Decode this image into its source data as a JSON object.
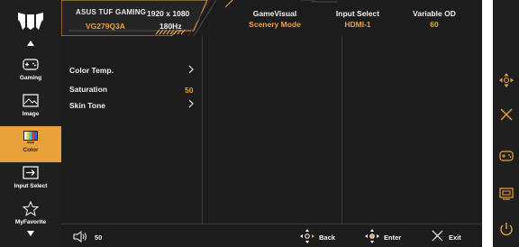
{
  "header": {
    "brand": "ASUS TUF GAMING",
    "model": "VG279Q3A",
    "resolution": "1920 x 1080",
    "refresh": "180Hz",
    "status": [
      {
        "label": "GameVisual",
        "value": "Scenery Mode"
      },
      {
        "label": "Input Select",
        "value": "HDMI-1"
      },
      {
        "label": "Variable OD",
        "value": "60"
      }
    ]
  },
  "sidebar": {
    "items": [
      {
        "label": "Gaming",
        "icon": "gamepad-icon"
      },
      {
        "label": "Image",
        "icon": "image-icon"
      },
      {
        "label": "Color",
        "icon": "color-bars-icon",
        "selected": true
      },
      {
        "label": "Input Select",
        "icon": "input-arrow-icon"
      },
      {
        "label": "MyFavorite",
        "icon": "star-icon"
      }
    ]
  },
  "menu": {
    "rows": [
      {
        "label": "Color Temp.",
        "value": "",
        "has_arrow": true
      },
      {
        "label": "Saturation",
        "value": "50",
        "has_arrow": false
      },
      {
        "label": "Skin Tone",
        "value": "",
        "has_arrow": true
      }
    ]
  },
  "bottom": {
    "volume": "50",
    "back": "Back",
    "enter": "Enter",
    "exit": "Exit"
  },
  "colors": {
    "accent": "#e9a13a",
    "background": "#1f1f1f",
    "text": "#f2f2f2"
  },
  "right_buttons": [
    "dpad-icon",
    "close-icon",
    "gamepad-icon",
    "input-icon",
    "power-icon"
  ]
}
